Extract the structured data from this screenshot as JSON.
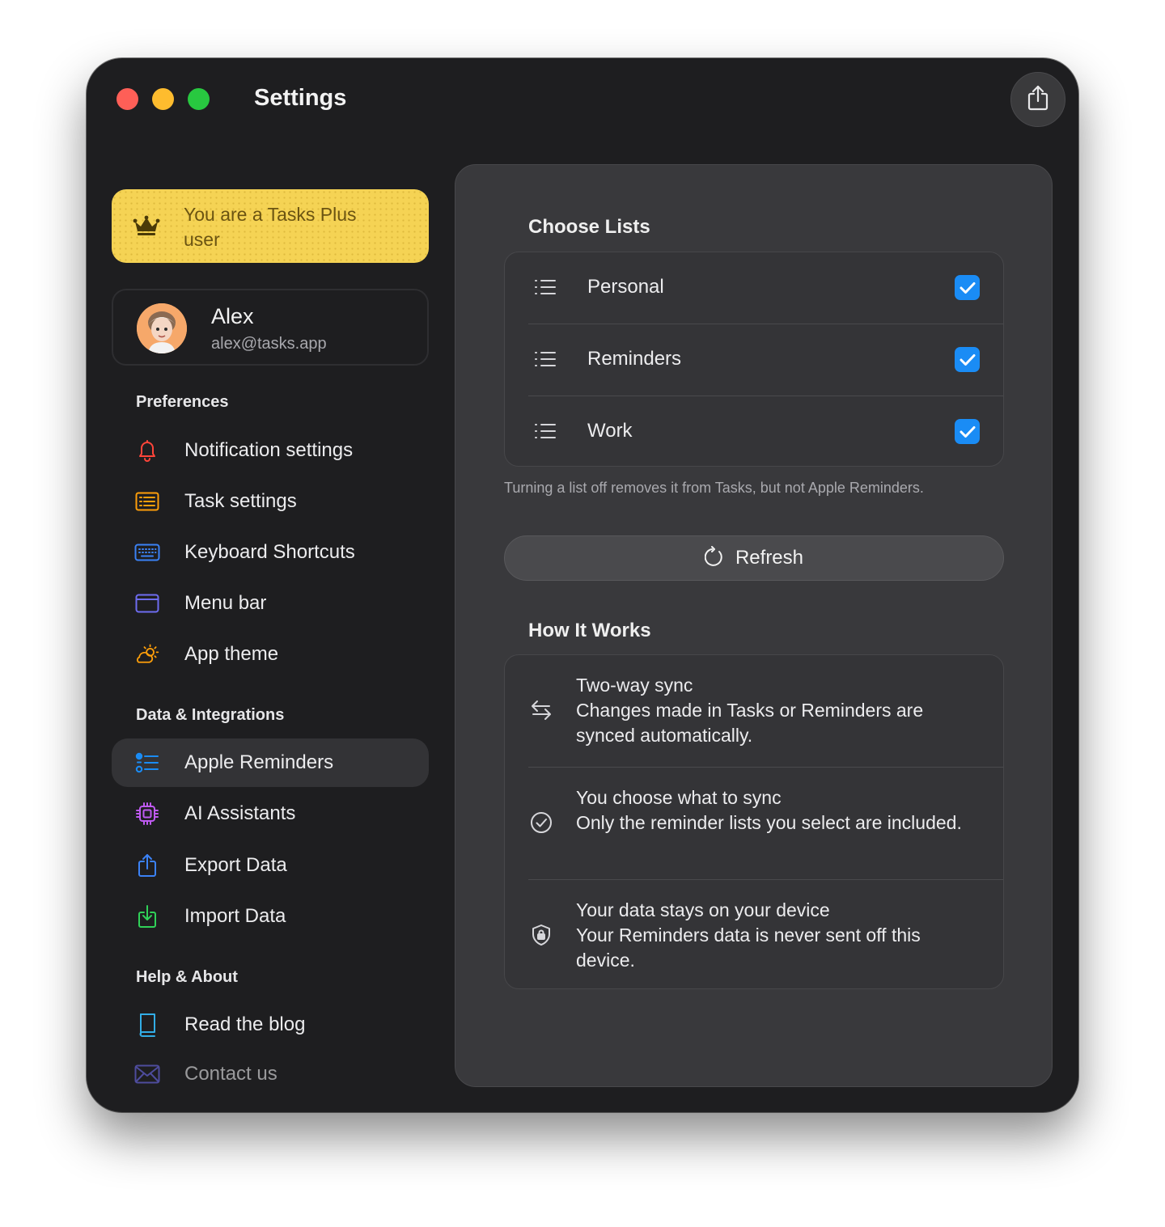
{
  "window": {
    "title": "Settings"
  },
  "plus_banner": {
    "text": "You are a Tasks Plus user"
  },
  "profile": {
    "name": "Alex",
    "email": "alex@tasks.app"
  },
  "sidebar": {
    "sections": [
      {
        "title": "Preferences",
        "items": [
          {
            "label": "Notification settings",
            "icon": "bell-icon",
            "color": "#ff453a"
          },
          {
            "label": "Task settings",
            "icon": "list-doc-icon",
            "color": "#ff9f0a"
          },
          {
            "label": "Keyboard Shortcuts",
            "icon": "keyboard-icon",
            "color": "#3b82f6"
          },
          {
            "label": "Menu bar",
            "icon": "window-icon",
            "color": "#6e6cf0"
          },
          {
            "label": "App theme",
            "icon": "sun-cloud-icon",
            "color": "#ff9f0a"
          }
        ]
      },
      {
        "title": "Data & Integrations",
        "items": [
          {
            "label": "Apple Reminders",
            "icon": "reminders-icon",
            "color": "#1a8cf5",
            "active": true
          },
          {
            "label": "AI Assistants",
            "icon": "chip-icon",
            "color": "#bf5af2"
          },
          {
            "label": "Export Data",
            "icon": "share-icon",
            "color": "#3b82f6"
          },
          {
            "label": "Import Data",
            "icon": "import-icon",
            "color": "#30d158"
          }
        ]
      },
      {
        "title": "Help & About",
        "items": [
          {
            "label": "Read the blog",
            "icon": "book-icon",
            "color": "#32ade6"
          },
          {
            "label": "Contact us",
            "icon": "envelope-icon",
            "color": "#6e6cf0"
          }
        ]
      }
    ]
  },
  "choose_lists": {
    "title": "Choose Lists",
    "lists": [
      {
        "label": "Personal",
        "checked": true
      },
      {
        "label": "Reminders",
        "checked": true
      },
      {
        "label": "Work",
        "checked": true
      }
    ],
    "note": "Turning a list off removes it from Tasks, but not Apple Reminders."
  },
  "refresh_button": {
    "label": "Refresh"
  },
  "how_it_works": {
    "title": "How It Works",
    "items": [
      {
        "icon": "sync-arrows-icon",
        "title": "Two-way sync",
        "body": "Changes made in Tasks or Reminders are synced automatically."
      },
      {
        "icon": "checkmark-circle-icon",
        "title": "You choose what to sync",
        "body": "Only the reminder lists you select are included."
      },
      {
        "icon": "lock-shield-icon",
        "title": "Your data stays on your device",
        "body": "Your Reminders data is never sent off this device."
      }
    ]
  },
  "colors": {
    "window_bg": "#1e1e20",
    "panel_bg": "#39393c",
    "accent": "#1a8cf5",
    "plus_yellow": "#f5d354"
  }
}
